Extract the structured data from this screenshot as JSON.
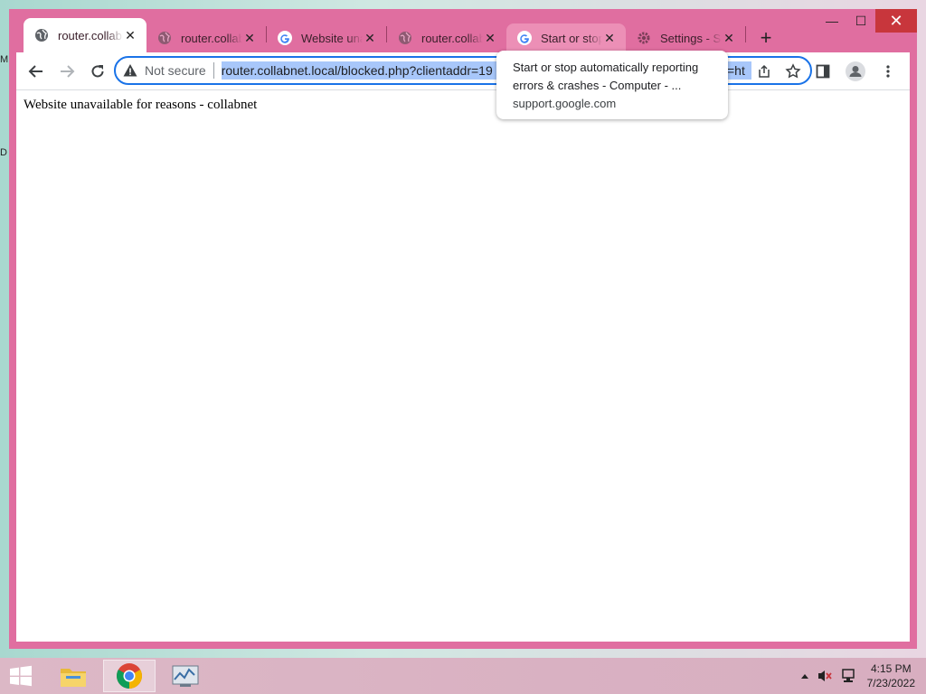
{
  "desktop": {
    "edge_glyph_top": "M",
    "edge_glyph_mid": "D"
  },
  "window": {
    "controls": {
      "minimize": "—",
      "maximize": "☐",
      "close": "✕"
    }
  },
  "tabs": [
    {
      "label": "router.collabnet.local",
      "favicon": "globe-icon",
      "active": true
    },
    {
      "label": "router.collabnet.local",
      "favicon": "globe-icon",
      "active": false
    },
    {
      "label": "Website unavailable",
      "favicon": "google-icon",
      "active": false
    },
    {
      "label": "router.collabnet.local",
      "favicon": "globe-icon",
      "active": false
    },
    {
      "label": "Start or stop automatically reporting",
      "favicon": "google-icon",
      "active": false,
      "hover": true
    },
    {
      "label": "Settings - System",
      "favicon": "gear-icon",
      "active": false
    }
  ],
  "new_tab_label": "+",
  "omnibox": {
    "security_label": "Not secure",
    "url": "router.collabnet.local/blocked.php?clientaddr=19",
    "url_tail": "=ht"
  },
  "page": {
    "text": "Website unavailable for reasons - collabnet"
  },
  "tooltip": {
    "title": "Start or stop automatically reporting errors & crashes - Computer - ...",
    "url": "support.google.com"
  },
  "taskbar": {
    "clock_time": "4:15 PM",
    "clock_date": "7/23/2022"
  },
  "colors": {
    "window_frame": "#e06ea0",
    "url_highlight": "#a8c7fa",
    "focus_ring": "#1a73e8"
  }
}
